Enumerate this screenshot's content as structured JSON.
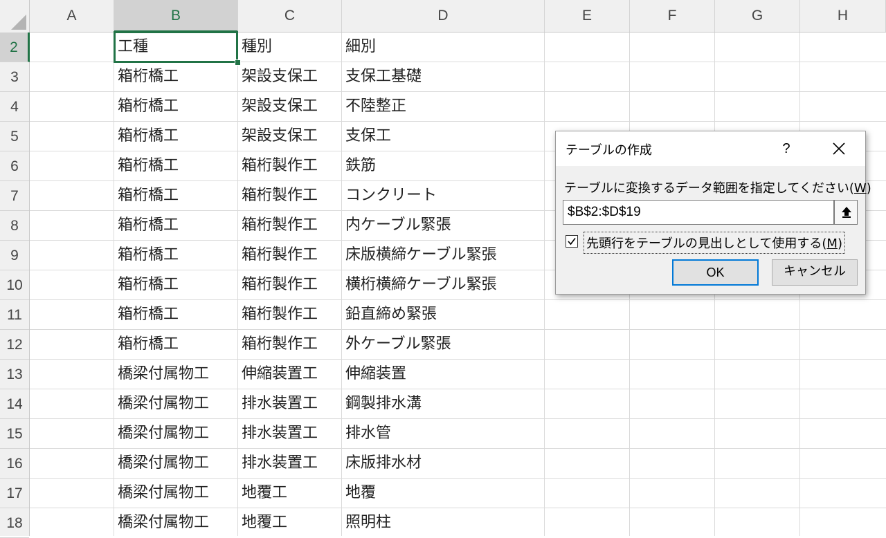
{
  "spreadsheet": {
    "columns": [
      "A",
      "B",
      "C",
      "D",
      "E",
      "F",
      "G",
      "H"
    ],
    "selected_column": "B",
    "rows": [
      {
        "num": "2",
        "b": "工種",
        "c": "種別",
        "d": "細別"
      },
      {
        "num": "3",
        "b": "箱桁橋工",
        "c": "架設支保工",
        "d": "支保工基礎"
      },
      {
        "num": "4",
        "b": "箱桁橋工",
        "c": "架設支保工",
        "d": "不陸整正"
      },
      {
        "num": "5",
        "b": "箱桁橋工",
        "c": "架設支保工",
        "d": "支保工"
      },
      {
        "num": "6",
        "b": "箱桁橋工",
        "c": "箱桁製作工",
        "d": "鉄筋"
      },
      {
        "num": "7",
        "b": "箱桁橋工",
        "c": "箱桁製作工",
        "d": "コンクリート"
      },
      {
        "num": "8",
        "b": "箱桁橋工",
        "c": "箱桁製作工",
        "d": "内ケーブル緊張"
      },
      {
        "num": "9",
        "b": "箱桁橋工",
        "c": "箱桁製作工",
        "d": "床版横締ケーブル緊張"
      },
      {
        "num": "10",
        "b": "箱桁橋工",
        "c": "箱桁製作工",
        "d": "横桁横締ケーブル緊張"
      },
      {
        "num": "11",
        "b": "箱桁橋工",
        "c": "箱桁製作工",
        "d": "鉛直締め緊張"
      },
      {
        "num": "12",
        "b": "箱桁橋工",
        "c": "箱桁製作工",
        "d": "外ケーブル緊張"
      },
      {
        "num": "13",
        "b": "橋梁付属物工",
        "c": "伸縮装置工",
        "d": "伸縮装置"
      },
      {
        "num": "14",
        "b": "橋梁付属物工",
        "c": "排水装置工",
        "d": "鋼製排水溝"
      },
      {
        "num": "15",
        "b": "橋梁付属物工",
        "c": "排水装置工",
        "d": "排水管"
      },
      {
        "num": "16",
        "b": "橋梁付属物工",
        "c": "排水装置工",
        "d": "床版排水材"
      },
      {
        "num": "17",
        "b": "橋梁付属物工",
        "c": "地覆工",
        "d": "地覆"
      },
      {
        "num": "18",
        "b": "橋梁付属物工",
        "c": "地覆工",
        "d": "照明柱"
      }
    ]
  },
  "dialog": {
    "title": "テーブルの作成",
    "help_label": "?",
    "prompt_text": "テーブルに変換するデータ範囲を指定してください(",
    "prompt_key": "W",
    "prompt_suffix": ")",
    "range_value": "$B$2:$D$19",
    "checkbox_text": "先頭行をテーブルの見出しとして使用する(",
    "checkbox_key": "M",
    "checkbox_suffix": ")",
    "checkbox_checked": true,
    "ok_label": "OK",
    "cancel_label": "キャンセル"
  },
  "colors": {
    "accent": "#217346",
    "focus_border": "#0078d7"
  },
  "icons": {
    "corner": "select-all-triangle-icon",
    "close": "close-x-icon",
    "collapse": "collapse-dialog-arrow-icon",
    "check": "checkmark-icon"
  }
}
